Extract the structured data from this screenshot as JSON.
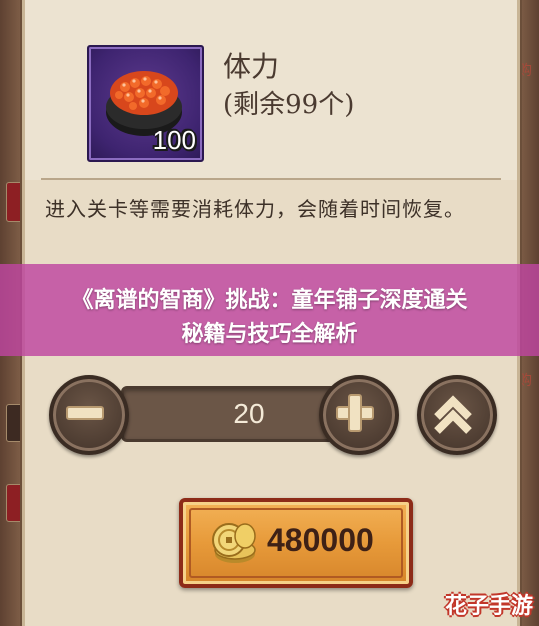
{
  "item": {
    "name": "体力",
    "remaining": "(剩余99个)",
    "icon_count": "100",
    "icon": "salmon-roe-sushi-icon"
  },
  "description": "进入关卡等需要消耗体力，会随着时间恢复。",
  "stepper": {
    "quantity": "20",
    "minus_icon": "minus-icon",
    "plus_icon": "plus-icon",
    "max_icon": "double-chevron-up-icon"
  },
  "purchase": {
    "price": "480000",
    "currency_icon": "gold-coins-icon"
  },
  "side_text": {
    "right_top": "购",
    "right_mid": "购"
  },
  "banner": {
    "line1": "《离谱的智商》挑战：童年铺子深度通关",
    "line2": "秘籍与技巧全解析"
  },
  "watermark": "花子手游",
  "colors": {
    "panel": "#e8dcc6",
    "banner": "#be46a0",
    "price_button": "#e79a3a",
    "icon_frame": "#3e2470"
  }
}
